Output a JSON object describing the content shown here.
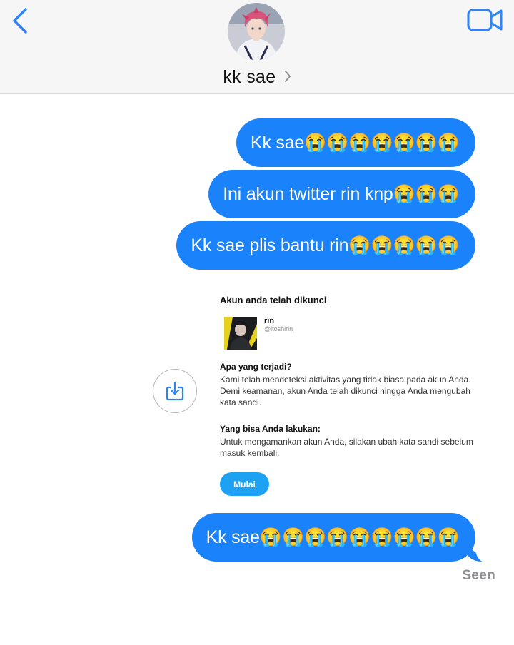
{
  "header": {
    "contact_name": "kk sae",
    "icons": {
      "back": "chevron-left-icon",
      "video": "video-camera-icon",
      "name_chevron": "chevron-right-icon"
    }
  },
  "messages": [
    {
      "text": "Kk sae",
      "emojis": "😭😭😭😭😭😭😭"
    },
    {
      "text": "Ini akun twitter rin knp",
      "emojis": "😭😭😭"
    },
    {
      "text": "Kk sae plis bantu rin",
      "emojis": "😭😭😭😭😭"
    },
    {
      "text": "Kk sae",
      "emojis": "😭😭😭😭😭😭😭😭😭"
    }
  ],
  "attachment": {
    "title": "Akun anda telah dikunci",
    "account_name": "rin",
    "account_handle": "@itoshirin_",
    "q1": "Apa yang terjadi?",
    "q1_text": "Kami telah mendeteksi aktivitas yang tidak biasa pada akun Anda. Demi keamanan, akun Anda telah dikunci hingga Anda mengubah kata sandi.",
    "q2": "Yang bisa Anda lakukan:",
    "q2_text": "Untuk mengamankan akun Anda, silakan ubah kata sandi sebelum masuk kembali.",
    "button": "Mulai"
  },
  "status": {
    "seen": "Seen"
  },
  "colors": {
    "bubble": "#1a82fb",
    "ios_blue": "#2d83fa",
    "twitter_blue": "#1da1f2"
  }
}
